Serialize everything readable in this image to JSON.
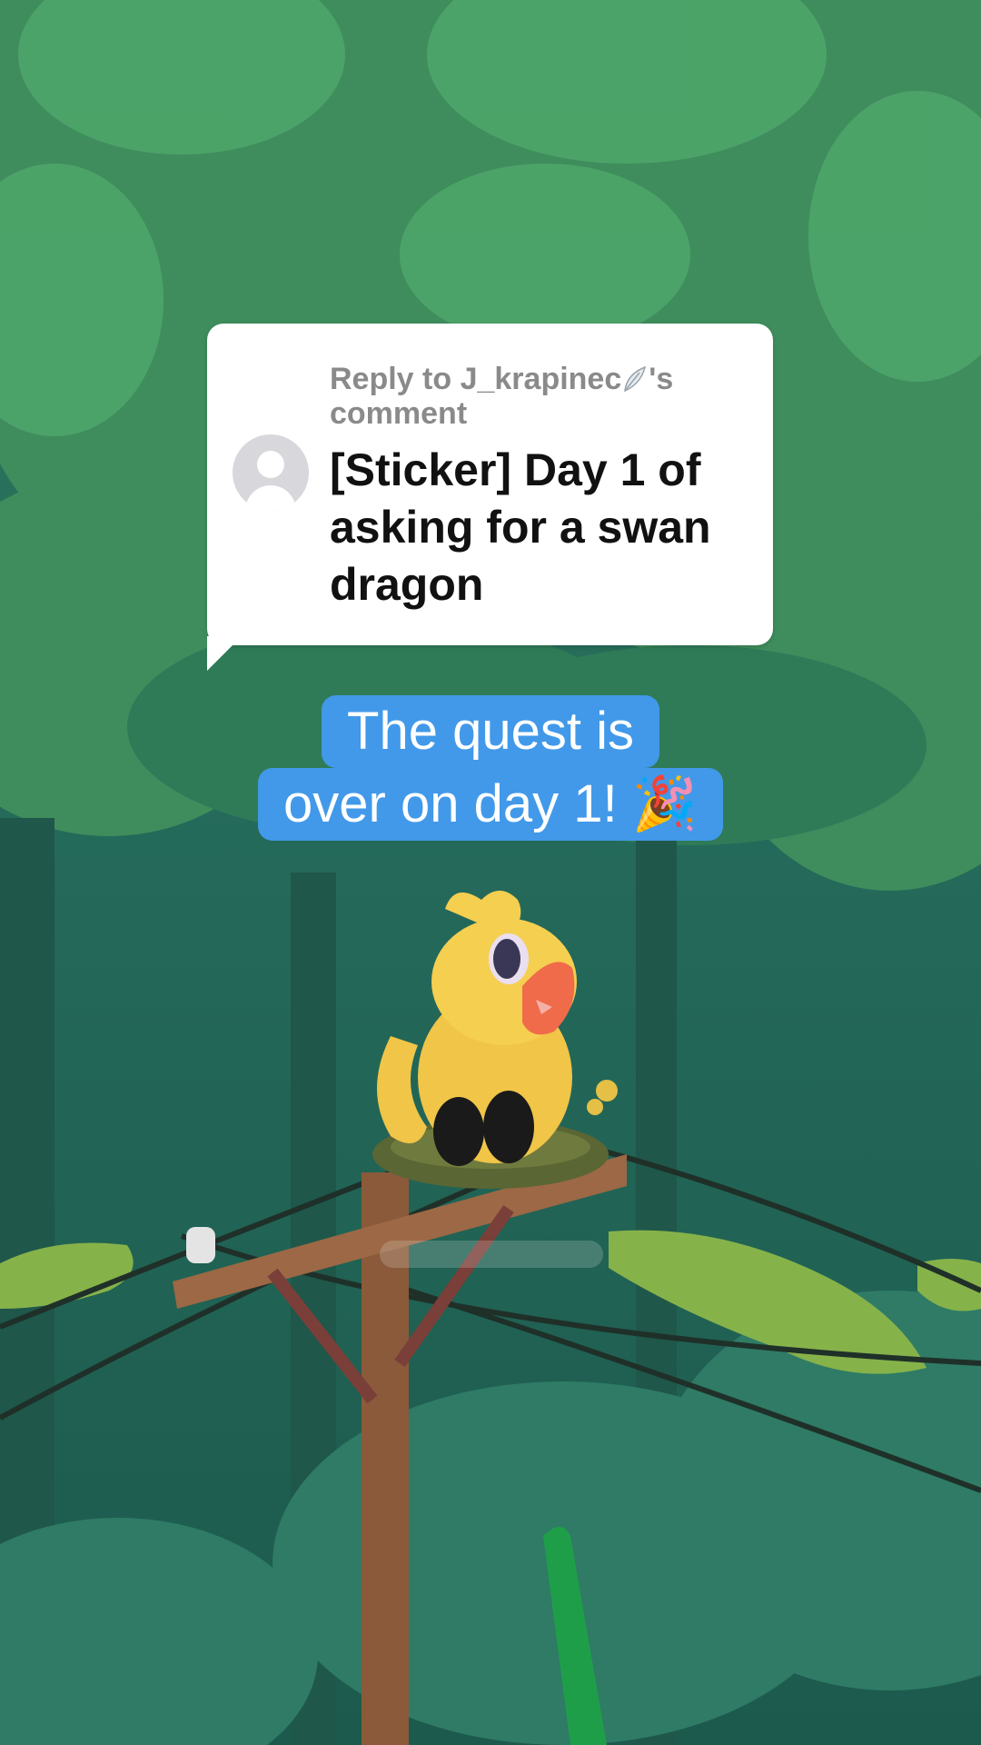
{
  "reply": {
    "header_prefix": "Reply to J_krapinec",
    "header_suffix": "'s",
    "header_line2": "comment",
    "text": "[Sticker] Day 1 of asking for a swan dragon"
  },
  "caption": {
    "line1": "The quest is",
    "line2": "over on day 1! 🎉"
  },
  "colors": {
    "caption_bg": "#4299e9",
    "forest_dark": "#1f5f4c",
    "tree_green": "#3f8d5d"
  }
}
